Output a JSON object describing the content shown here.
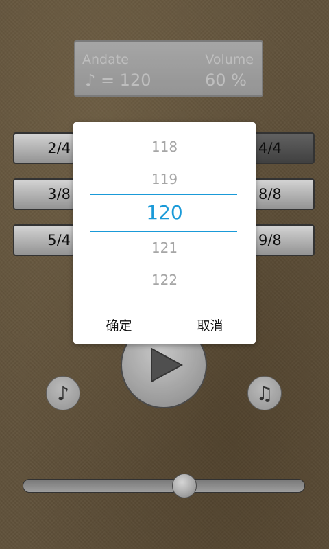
{
  "display": {
    "tempo_name": "Andate",
    "tempo_value": "♪ = 120",
    "volume_label": "Volume",
    "volume_value": "60 %"
  },
  "time_signatures": {
    "left": [
      "2/4",
      "3/8",
      "5/4"
    ],
    "right": [
      "4/4",
      "8/8",
      "9/8"
    ],
    "active": "4/4"
  },
  "icons": {
    "play": "play-icon",
    "single_note": "eighth-note-icon",
    "double_note": "beamed-notes-icon"
  },
  "slider": {
    "value": 0.58
  },
  "dialog": {
    "picker_values": [
      "118",
      "119",
      "120",
      "121",
      "122"
    ],
    "selected": "120",
    "confirm_label": "确定",
    "cancel_label": "取消"
  },
  "colors": {
    "accent": "#1a9ad8",
    "background": "#6e5d43"
  }
}
